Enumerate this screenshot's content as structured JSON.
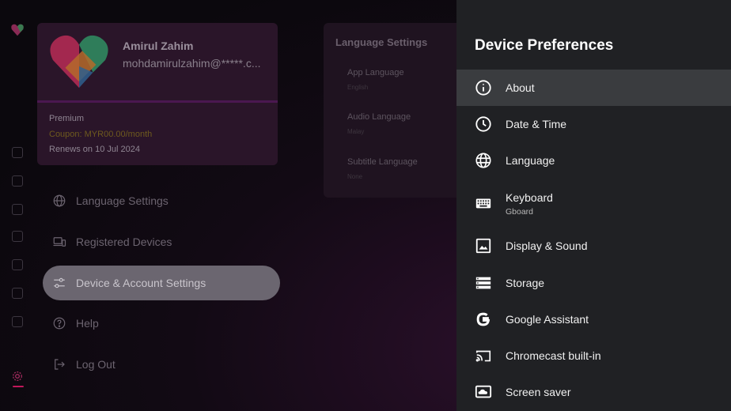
{
  "profile": {
    "name": "Amirul Zahim",
    "email": "mohdamirulzahim@*****.c...",
    "plan": "Premium",
    "coupon": "Coupon: MYR00.00/month",
    "renewal": "Renews on 10 Jul 2024"
  },
  "language_settings": {
    "title": "Language Settings",
    "items": [
      {
        "label": "App Language",
        "value": "English"
      },
      {
        "label": "Audio Language",
        "value": "Malay"
      },
      {
        "label": "Subtitle Language",
        "value": "None"
      }
    ]
  },
  "settings_menu": [
    {
      "label": "Language Settings",
      "icon": "globe-icon"
    },
    {
      "label": "Registered Devices",
      "icon": "devices-icon"
    },
    {
      "label": "Device & Account Settings",
      "icon": "sliders-icon",
      "selected": true
    },
    {
      "label": "Help",
      "icon": "help-circle-icon"
    },
    {
      "label": "Log Out",
      "icon": "logout-icon"
    }
  ],
  "device_preferences": {
    "title": "Device Preferences",
    "items": [
      {
        "label": "About",
        "icon": "info-icon",
        "focused": true
      },
      {
        "label": "Date & Time",
        "icon": "clock-icon"
      },
      {
        "label": "Language",
        "icon": "globe-icon"
      },
      {
        "label": "Keyboard",
        "subtitle": "Gboard",
        "icon": "keyboard-icon"
      },
      {
        "label": "Display & Sound",
        "icon": "image-icon"
      },
      {
        "label": "Storage",
        "icon": "storage-icon"
      },
      {
        "label": "Google Assistant",
        "icon": "google-icon"
      },
      {
        "label": "Chromecast built-in",
        "icon": "cast-icon"
      },
      {
        "label": "Screen saver",
        "icon": "screensaver-icon"
      }
    ]
  },
  "colors": {
    "panel_bg": "#202124",
    "focused_bg": "#3a3c3f",
    "accent_pink": "#c2185b",
    "selected_menu_bg": "#6b6670"
  }
}
